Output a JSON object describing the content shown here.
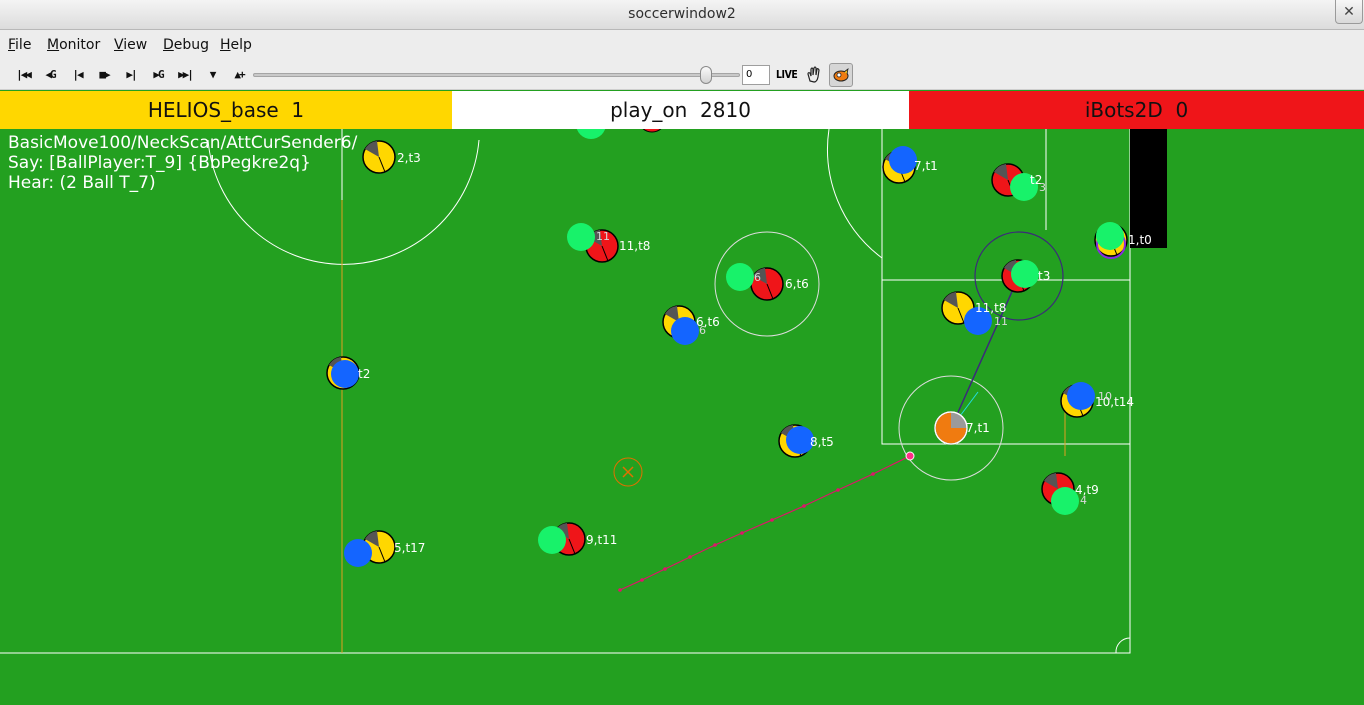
{
  "window": {
    "title": "soccerwindow2"
  },
  "menu": [
    {
      "label": "File",
      "mnemonic": "F",
      "rest": "ile"
    },
    {
      "label": "Monitor",
      "mnemonic": "M",
      "rest": "onitor"
    },
    {
      "label": "View",
      "mnemonic": "V",
      "rest": "iew"
    },
    {
      "label": "Debug",
      "mnemonic": "D",
      "rest": "ebug"
    },
    {
      "label": "Help",
      "mnemonic": "H",
      "rest": "elp"
    }
  ],
  "toolbar": {
    "buttons": [
      "go-first-icon",
      "rewind-icon",
      "step-back-icon",
      "play-icon",
      "step-forward-icon",
      "fast-forward-icon",
      "go-last-icon",
      "record-icon",
      "zoom-icon"
    ],
    "cycle_value": "0",
    "slider_position": 0.93,
    "live_label": "LIVE",
    "extra_icons": [
      "drag-hand-icon",
      "monitor-logo-icon"
    ]
  },
  "scoreboard": {
    "left_team": "HELIOS_base  1",
    "play_mode": "play_on  2810",
    "right_team": "iBots2D  0",
    "left_color": "#ffd700",
    "right_color": "#ef1519"
  },
  "info_text": [
    "BasicMove100/NeckScan/AttCurSender6/",
    "Say: [BallPlayer:T_9] {BbPegkre2q}",
    "Hear: (2 Ball T_7)"
  ],
  "players": [
    {
      "team": "yellow",
      "label": "2,t3"
    },
    {
      "team": "yellow",
      "label": "7,t1"
    },
    {
      "team": "red",
      "label": "t2"
    },
    {
      "team": "red",
      "label": "3"
    },
    {
      "team": "yellow",
      "label": "1,t0"
    },
    {
      "team": "red",
      "label": "11,t8"
    },
    {
      "team": "red",
      "label": "11"
    },
    {
      "team": "red",
      "label": "6,t6"
    },
    {
      "team": "red",
      "label": "6"
    },
    {
      "team": "red",
      "label": "t3"
    },
    {
      "team": "yellow",
      "label": "6,t6"
    },
    {
      "team": "yellow",
      "label": "6"
    },
    {
      "team": "yellow",
      "label": "11,t8"
    },
    {
      "team": "yellow",
      "label": "11"
    },
    {
      "team": "yellow",
      "label": "t2"
    },
    {
      "team": "yellow",
      "label": "10,t14"
    },
    {
      "team": "yellow",
      "label": "10"
    },
    {
      "team": "yellow",
      "label": "8,t5"
    },
    {
      "team": "red",
      "label": "7,t1"
    },
    {
      "team": "red",
      "label": "4,t9"
    },
    {
      "team": "red",
      "label": "4"
    },
    {
      "team": "yellow",
      "label": "5,t17"
    },
    {
      "team": "red",
      "label": "9,t11"
    }
  ]
}
